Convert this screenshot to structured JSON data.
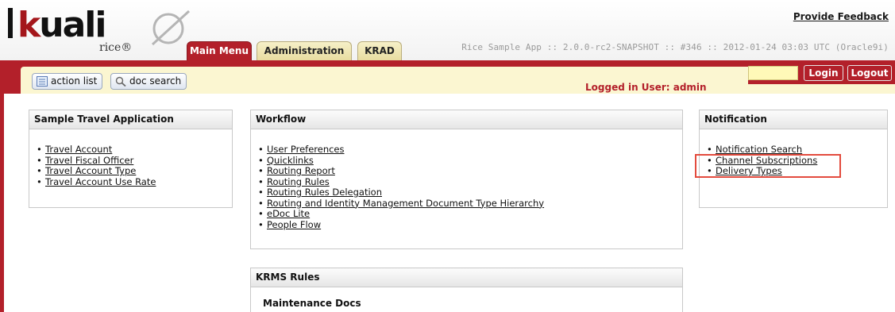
{
  "header": {
    "logo": {
      "wordmark_k": "k",
      "wordmark_rest": "uali",
      "subtitle": "rice®"
    },
    "feedback_link": "Provide Feedback",
    "build_info": "Rice Sample App :: 2.0.0-rc2-SNAPSHOT :: #346 :: 2012-01-24 03:03 UTC (Oracle9i)",
    "tabs": [
      {
        "label": "Main Menu",
        "active": true
      },
      {
        "label": "Administration",
        "active": false
      },
      {
        "label": "KRAD",
        "active": false
      }
    ]
  },
  "toolbar": {
    "action_list_label": "action list",
    "doc_search_label": "doc search",
    "logged_in_label": "Logged in User: admin",
    "login_label": "Login",
    "logout_label": "Logout",
    "login_input_value": ""
  },
  "panels": {
    "travel": {
      "title": "Sample Travel Application",
      "links": [
        "Travel Account",
        "Travel Fiscal Officer",
        "Travel Account Type",
        "Travel Account Use Rate"
      ]
    },
    "workflow": {
      "title": "Workflow",
      "links": [
        "User Preferences",
        "Quicklinks",
        "Routing Report",
        "Routing Rules",
        "Routing Rules Delegation",
        "Routing and Identity Management Document Type Hierarchy",
        "eDoc Lite",
        "People Flow"
      ]
    },
    "notification": {
      "title": "Notification",
      "links": [
        "Notification Search",
        "Channel Subscriptions",
        "Delivery Types"
      ]
    },
    "krms": {
      "title": "KRMS Rules",
      "subhead": "Maintenance Docs"
    }
  },
  "colors": {
    "brand_red": "#b3202a",
    "toolbar_cream": "#fbf6d1",
    "highlight_outline": "#e34b3e"
  }
}
